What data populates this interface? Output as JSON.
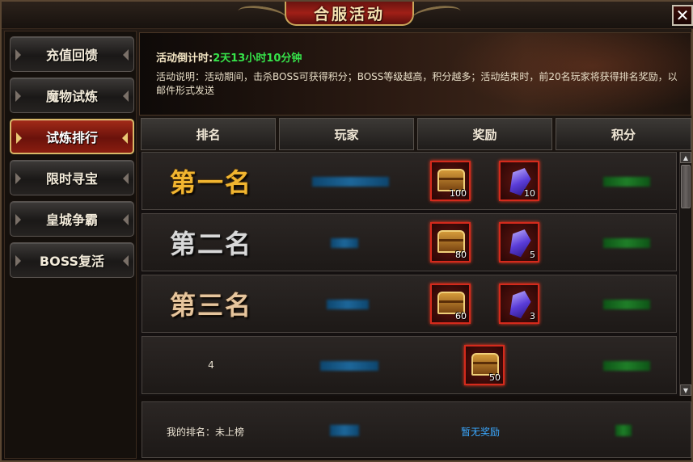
{
  "window": {
    "title": "合服活动",
    "close_glyph": "✕"
  },
  "sidebar": {
    "items": [
      {
        "label": "充值回馈",
        "active": false
      },
      {
        "label": "魔物试炼",
        "active": false
      },
      {
        "label": "试炼排行",
        "active": true
      },
      {
        "label": "限时寻宝",
        "active": false
      },
      {
        "label": "皇城争霸",
        "active": false
      },
      {
        "label": "BOSS复活",
        "active": false
      }
    ]
  },
  "banner": {
    "countdown_label": "活动倒计时:",
    "countdown_value": "2天13小时10分钟",
    "description": "活动说明：活动期间，击杀BOSS可获得积分；BOSS等级越高，积分越多；活动结束时，前20名玩家将获得排名奖励，以邮件形式发送"
  },
  "table": {
    "headers": [
      "排名",
      "玩家",
      "奖励",
      "积分"
    ],
    "rows": [
      {
        "rank_text": "第一名",
        "rewards": [
          {
            "icon": "treasure-chest-icon",
            "count": "100"
          },
          {
            "icon": "purple-gem-icon",
            "count": "10"
          }
        ]
      },
      {
        "rank_text": "第二名",
        "rewards": [
          {
            "icon": "treasure-chest-icon",
            "count": "80"
          },
          {
            "icon": "purple-gem-icon",
            "count": "5"
          }
        ]
      },
      {
        "rank_text": "第三名",
        "rewards": [
          {
            "icon": "treasure-chest-icon",
            "count": "60"
          },
          {
            "icon": "purple-gem-icon",
            "count": "3"
          }
        ]
      },
      {
        "rank_text": "4",
        "rewards": [
          {
            "icon": "treasure-chest-icon",
            "count": "50"
          }
        ]
      }
    ]
  },
  "my_rank": {
    "label": "我的排名：未上榜",
    "reward_text": "暂无奖励"
  },
  "colors": {
    "countdown_value": "#36e34a",
    "reward_link": "#3aa8ff",
    "active_tab": "#a22a18"
  }
}
